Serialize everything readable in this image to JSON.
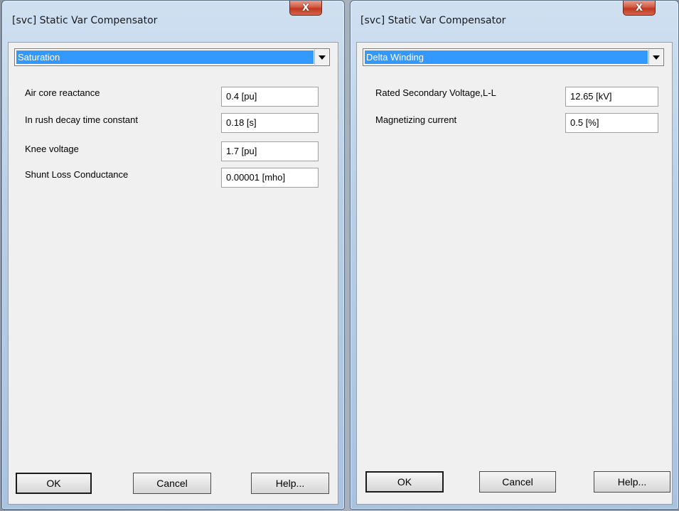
{
  "left_dialog": {
    "title": "[svc] Static Var Compensator",
    "close_glyph": "X",
    "category": "Saturation",
    "parameters": [
      {
        "label": "Air core reactance",
        "value": "0.4 [pu]"
      },
      {
        "label": "In rush decay time constant",
        "value": "0.18 [s]"
      },
      {
        "label": "Knee voltage",
        "value": "1.7 [pu]"
      },
      {
        "label": "Shunt Loss Conductance",
        "value": "0.00001 [mho]"
      }
    ],
    "buttons": {
      "ok": "OK",
      "cancel": "Cancel",
      "help": "Help..."
    }
  },
  "right_dialog": {
    "title": "[svc] Static Var Compensator",
    "close_glyph": "X",
    "category": "Delta Winding",
    "parameters": [
      {
        "label": "Rated Secondary Voltage,L-L",
        "value": "12.65 [kV]"
      },
      {
        "label": "Magnetizing current",
        "value": "0.5 [%]"
      }
    ],
    "buttons": {
      "ok": "OK",
      "cancel": "Cancel",
      "help": "Help..."
    }
  },
  "colors": {
    "selection": "#3399ff",
    "close_button": "#c1371f",
    "client_bg": "#f0f0f0"
  }
}
